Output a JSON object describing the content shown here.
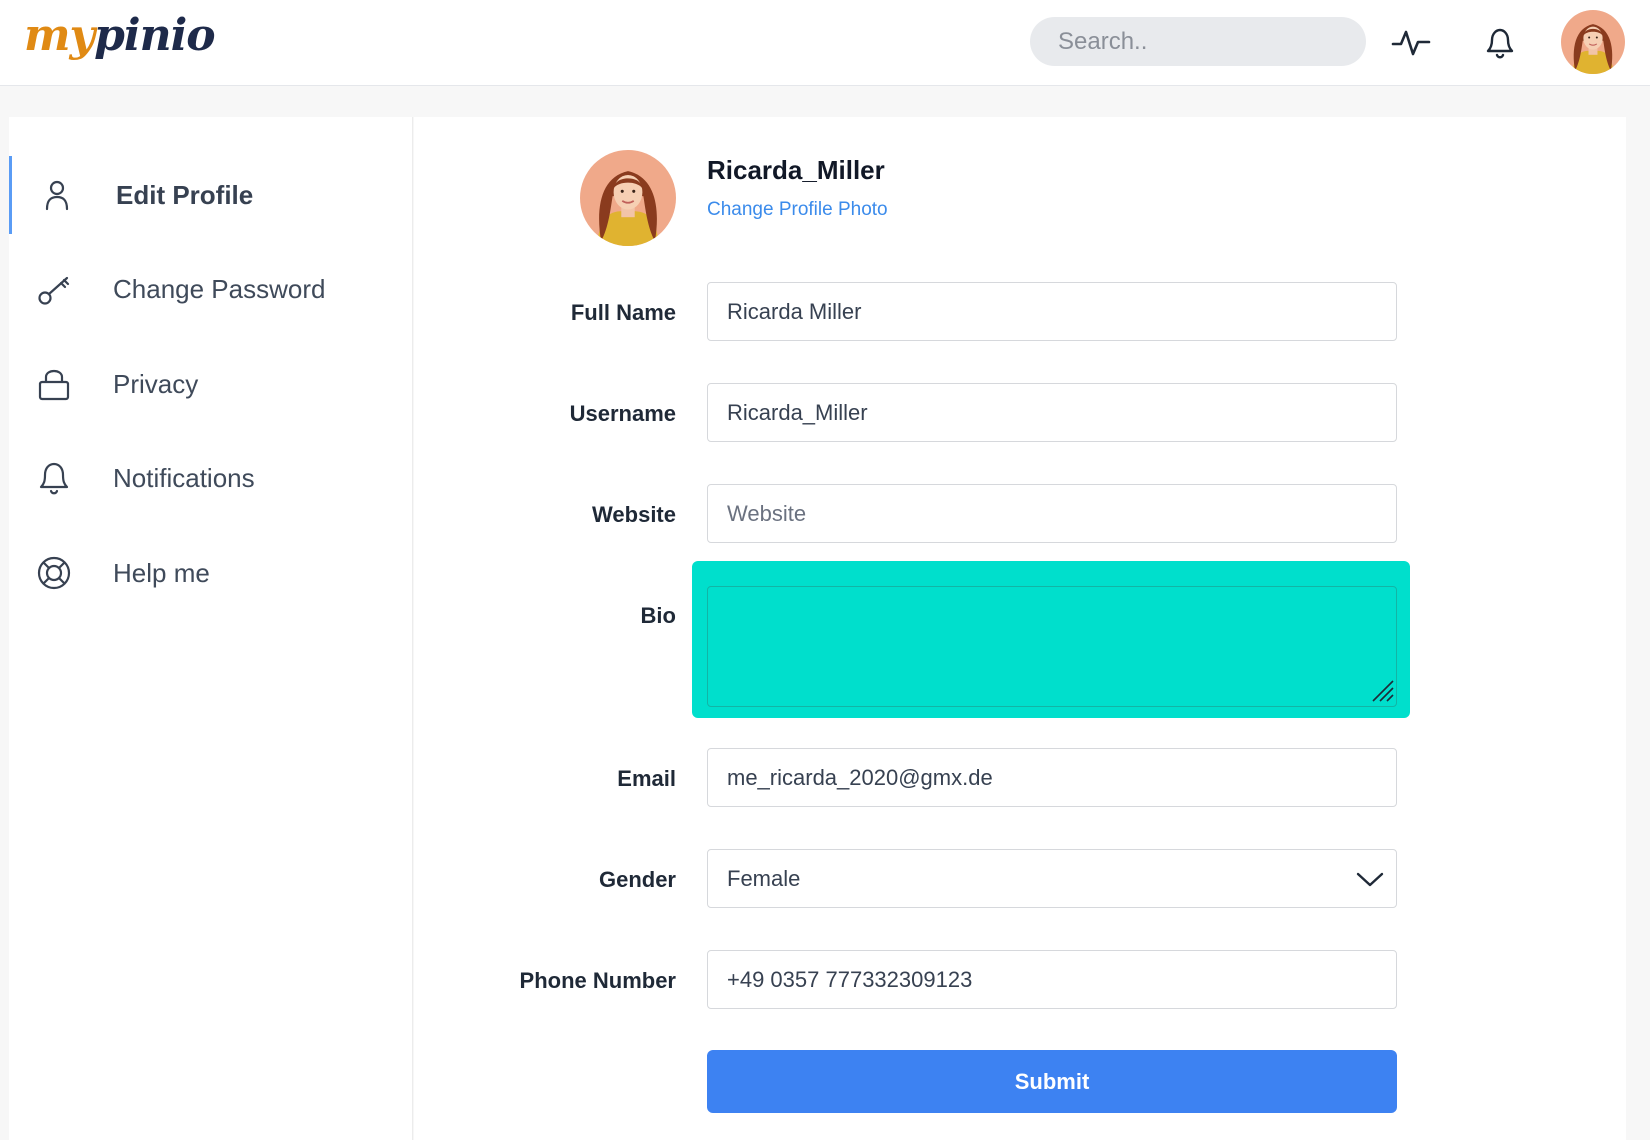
{
  "header": {
    "logo_part1": "my",
    "logo_part2": "pinio",
    "search_placeholder": "Search..",
    "icons": [
      "activity-icon",
      "bell-icon"
    ],
    "avatar": "user-avatar"
  },
  "sidebar": {
    "items": [
      {
        "label": "Edit Profile",
        "icon": "user-icon",
        "active": true
      },
      {
        "label": "Change Password",
        "icon": "key-icon",
        "active": false
      },
      {
        "label": "Privacy",
        "icon": "lock-icon",
        "active": false
      },
      {
        "label": "Notifications",
        "icon": "bell-icon",
        "active": false
      },
      {
        "label": "Help me",
        "icon": "lifebuoy-icon",
        "active": false
      }
    ]
  },
  "profile": {
    "username": "Ricarda_Miller",
    "change_photo": "Change Profile Photo"
  },
  "form": {
    "full_name": {
      "label": "Full Name",
      "value": "Ricarda Miller"
    },
    "username": {
      "label": "Username",
      "value": "Ricarda_Miller"
    },
    "website": {
      "label": "Website",
      "value": "",
      "placeholder": "Website"
    },
    "bio": {
      "label": "Bio",
      "value": ""
    },
    "email": {
      "label": "Email",
      "value": "me_ricarda_2020@gmx.de"
    },
    "gender": {
      "label": "Gender",
      "value": "Female"
    },
    "phone": {
      "label": "Phone Number",
      "value": "+49 0357 777332309123"
    },
    "submit": "Submit"
  },
  "colors": {
    "accent": "#3d82f2",
    "link": "#3b8beb",
    "bio_highlight": "#00dfcc",
    "logo_orange": "#e08a14",
    "logo_navy": "#1e2a4a"
  }
}
